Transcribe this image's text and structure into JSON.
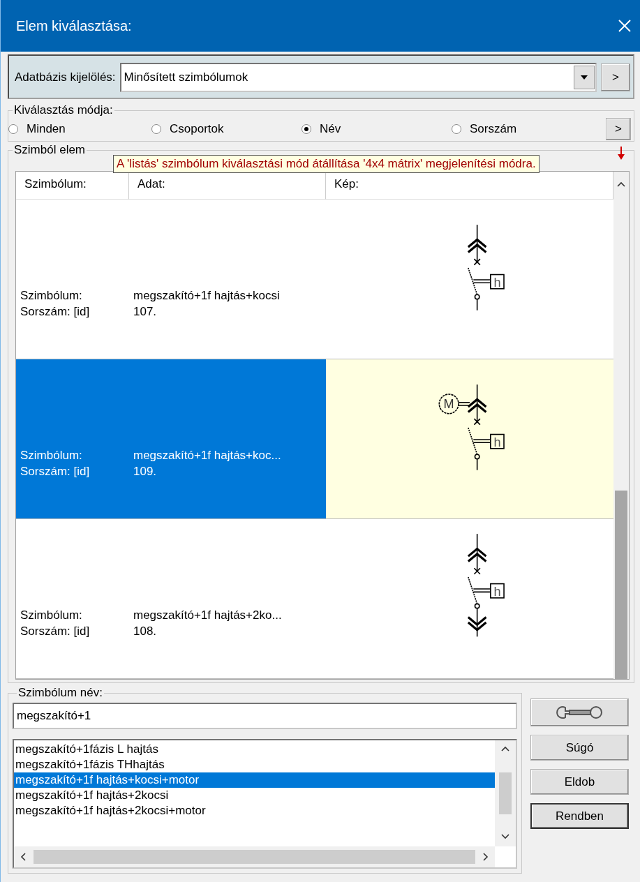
{
  "window": {
    "title": "Elem kiválasztása:"
  },
  "database": {
    "label": "Adatbázis kijelölés:",
    "value": "Minősített szimbólumok",
    "next_button": ">"
  },
  "selection_mode": {
    "title": "Kiválasztás módja:",
    "options": [
      {
        "label": "Minden",
        "selected": false
      },
      {
        "label": "Csoportok",
        "selected": false
      },
      {
        "label": "Név",
        "selected": true
      },
      {
        "label": "Sorszám",
        "selected": false
      }
    ],
    "next_button": ">",
    "tooltip": "A 'listás' szimbólum kiválasztási mód átállítása '4x4 mátrix' megjelenítési módra."
  },
  "symbol_list": {
    "title": "Szimból elem",
    "columns": [
      "Szimbólum:",
      "Adat:",
      "Kép:"
    ],
    "rows": [
      {
        "labels": [
          "Szimbólum:",
          "Sorszám: [id]"
        ],
        "values": [
          "megszakító+1f hajtás+kocsi",
          "107."
        ],
        "selected": false,
        "symbol": {
          "kind": "basic",
          "actuator": "h"
        }
      },
      {
        "labels": [
          "Szimbólum:",
          "Sorszám: [id]"
        ],
        "values": [
          "megszakító+1f hajtás+koc...",
          "109."
        ],
        "selected": true,
        "symbol": {
          "kind": "motor",
          "actuator": "h",
          "motor": "M"
        }
      },
      {
        "labels": [
          "Szimbólum:",
          "Sorszám: [id]"
        ],
        "values": [
          "megszakító+1f hajtás+2ko...",
          "108."
        ],
        "selected": false,
        "symbol": {
          "kind": "double",
          "actuator": "h"
        }
      }
    ]
  },
  "name_search": {
    "title": "Szimbólum név:",
    "value": "megszakító+1",
    "items": [
      {
        "label": "megszakító+1fázis L hajtás",
        "selected": false
      },
      {
        "label": "megszakító+1fázis THhajtás",
        "selected": false
      },
      {
        "label": "megszakító+1f hajtás+kocsi+motor",
        "selected": true
      },
      {
        "label": "megszakító+1f hajtás+2kocsi",
        "selected": false
      },
      {
        "label": "megszakító+1f hajtás+2kocsi+motor",
        "selected": false
      }
    ]
  },
  "buttons": [
    {
      "label": "Súgó",
      "default": false
    },
    {
      "label": "Eldob",
      "default": false
    },
    {
      "label": "Rendben",
      "default": true
    }
  ]
}
